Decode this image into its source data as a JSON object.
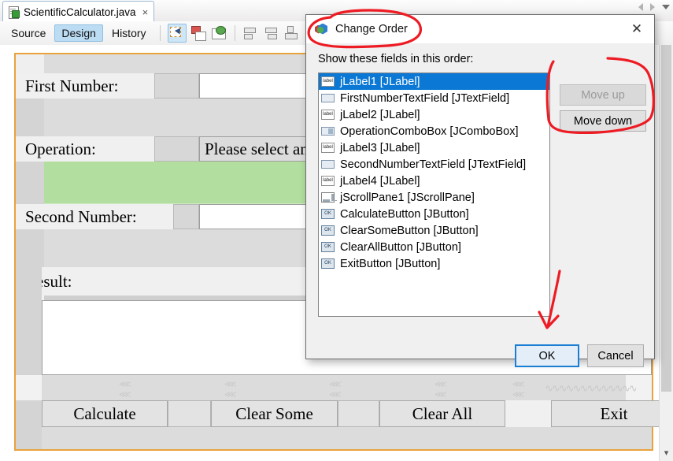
{
  "ide": {
    "file_tab": {
      "name": "ScientificCalculator.java",
      "close": "×",
      "icon": "java-file-icon"
    },
    "tab_nav": {
      "left": "scroll-left-arrow",
      "right": "scroll-right-arrow",
      "list": "tab-list-dropdown"
    },
    "view_tabs": [
      {
        "label": "Source",
        "active": false
      },
      {
        "label": "Design",
        "active": true
      },
      {
        "label": "History",
        "active": false
      }
    ],
    "toolbar_icons": [
      "selection-mode-icon",
      "connection-mode-icon",
      "preview-design-icon",
      "align-left-icon",
      "align-center-icon",
      "align-middle-icon",
      "align-right-icon",
      "align-top-icon"
    ]
  },
  "designer": {
    "labels": {
      "first_number": "First Number:",
      "operation": "Operation:",
      "second_number": "Second Number:",
      "result": "Result:"
    },
    "combo_value": "Please select an",
    "buttons": [
      {
        "label": "Calculate"
      },
      {
        "label": "Clear Some"
      },
      {
        "label": "Clear All"
      },
      {
        "label": "Exit"
      }
    ],
    "colors": {
      "form_border": "#e8a33d",
      "selection_green": "#b2dfa0",
      "panel": "#f0f0f0"
    }
  },
  "dialog": {
    "title": "Change Order",
    "icon": "netbeans-cube-icon",
    "close": "✕",
    "prompt": "Show these fields in this order:",
    "items": [
      {
        "label": "jLabel1 [JLabel]",
        "icon": "jlabel-icon",
        "selected": true
      },
      {
        "label": "FirstNumberTextField [JTextField]",
        "icon": "jtextfield-icon",
        "selected": false
      },
      {
        "label": "jLabel2 [JLabel]",
        "icon": "jlabel-icon",
        "selected": false
      },
      {
        "label": "OperationComboBox [JComboBox]",
        "icon": "jcombobox-icon",
        "selected": false
      },
      {
        "label": "jLabel3 [JLabel]",
        "icon": "jlabel-icon",
        "selected": false
      },
      {
        "label": "SecondNumberTextField [JTextField]",
        "icon": "jtextfield-icon",
        "selected": false
      },
      {
        "label": "jLabel4 [JLabel]",
        "icon": "jlabel-icon",
        "selected": false
      },
      {
        "label": "jScrollPane1 [JScrollPane]",
        "icon": "jscrollpane-icon",
        "selected": false
      },
      {
        "label": "CalculateButton [JButton]",
        "icon": "jbutton-icon",
        "selected": false
      },
      {
        "label": "ClearSomeButton [JButton]",
        "icon": "jbutton-icon",
        "selected": false
      },
      {
        "label": "ClearAllButton [JButton]",
        "icon": "jbutton-icon",
        "selected": false
      },
      {
        "label": "ExitButton [JButton]",
        "icon": "jbutton-icon",
        "selected": false
      }
    ],
    "move_up": {
      "label": "Move up",
      "enabled": false
    },
    "move_down": {
      "label": "Move down",
      "enabled": true
    },
    "ok": {
      "label": "OK",
      "focused": true
    },
    "cancel": {
      "label": "Cancel"
    },
    "selection_color": "#0a78d4",
    "focus_color": "#1a7fd4"
  },
  "annotations": {
    "color": "#ed1c24",
    "marks": [
      "ellipse-around-change-order-title",
      "bracket-around-move-buttons",
      "arrow-pointing-to-ok-button"
    ]
  }
}
